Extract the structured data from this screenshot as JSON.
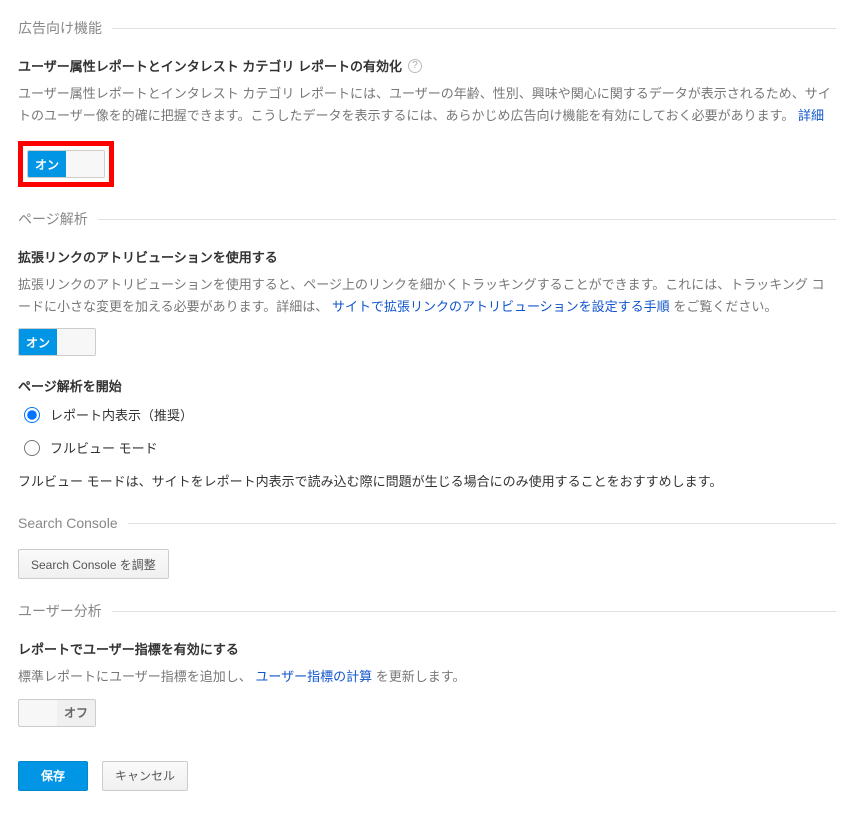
{
  "sections": {
    "ads": {
      "title": "広告向け機能",
      "demographics": {
        "heading": "ユーザー属性レポートとインタレスト カテゴリ レポートの有効化",
        "description": "ユーザー属性レポートとインタレスト カテゴリ レポートには、ユーザーの年齢、性別、興味や関心に関するデータが表示されるため、サイトのユーザー像を的確に把握できます。こうしたデータを表示するには、あらかじめ広告向け機能を有効にしておく必要があります。",
        "link": "詳細",
        "toggle_on": "オン"
      }
    },
    "page_analytics": {
      "title": "ページ解析",
      "enhanced_link": {
        "heading": "拡張リンクのアトリビューションを使用する",
        "description": "拡張リンクのアトリビューションを使用すると、ページ上のリンクを細かくトラッキングすることができます。これには、トラッキング コードに小さな変更を加える必要があります。詳細は、",
        "link": "サイトで拡張リンクのアトリビューションを設定する手順",
        "description_tail": "をご覧ください。",
        "toggle_on": "オン"
      },
      "start": {
        "heading": "ページ解析を開始",
        "option1": "レポート内表示（推奨）",
        "option2": "フルビュー モード",
        "note": "フルビュー モードは、サイトをレポート内表示で読み込む際に問題が生じる場合にのみ使用することをおすすめします。"
      }
    },
    "search_console": {
      "title": "Search Console",
      "button": "Search Console を調整"
    },
    "user_analysis": {
      "title": "ユーザー分析",
      "metrics": {
        "heading": "レポートでユーザー指標を有効にする",
        "description_prefix": "標準レポートにユーザー指標を追加し、",
        "link": "ユーザー指標の計算",
        "description_suffix": "を更新します。",
        "toggle_off": "オフ"
      }
    }
  },
  "footer": {
    "save": "保存",
    "cancel": "キャンセル"
  }
}
